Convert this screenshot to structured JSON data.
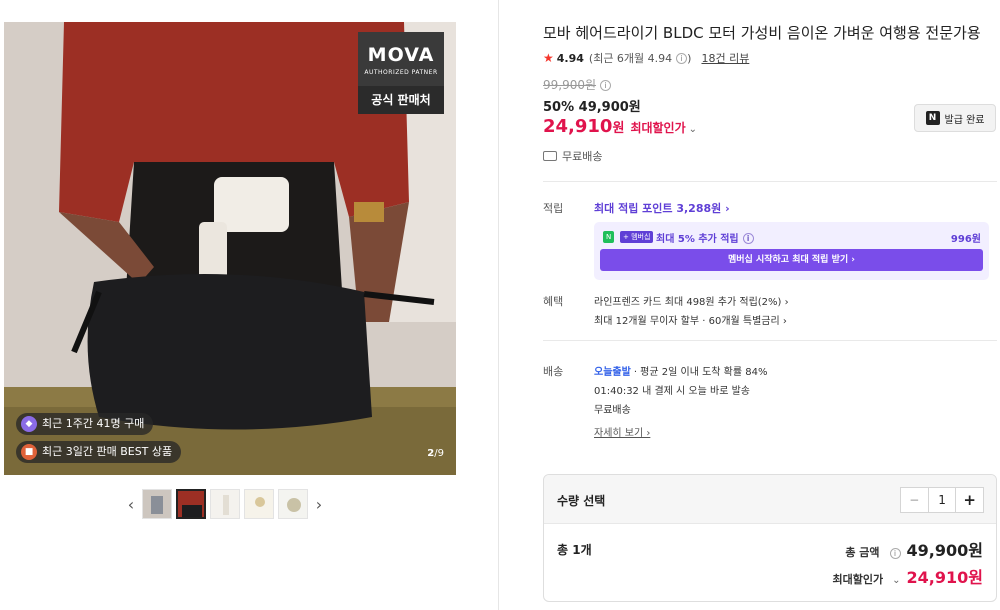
{
  "gallery": {
    "brand_logo": "MOVA",
    "brand_sub": "AUTHORIZED PATNER",
    "brand_foot": "공식 판매처",
    "badge_recent": "최근 1주간 41명 구매",
    "badge_best": "최근 3일간 판매 BEST 상품",
    "counter_current": "2",
    "counter_total": "/9",
    "prev_arrow": "‹",
    "next_arrow": "›"
  },
  "product": {
    "title": "모바 헤어드라이기 BLDC 모터 가성비 음이온 가벼운 여행용 전문가용",
    "rating": "4.94",
    "rating_recent": "(최근 6개월 4.94",
    "rating_recent_close": ")",
    "review_link": "18건 리뷰",
    "original_price": "99,900원",
    "discount": "50% 49,900원",
    "final_price": "24,910",
    "won": "원",
    "max_discount_label": "최대할인가",
    "coupon_button": "발급 완료",
    "shipping": "무료배송"
  },
  "points": {
    "label": "적립",
    "link": "최대 적립 포인트 3,288원 ›",
    "tag_n": "N",
    "tag_member": "+ 멤버십",
    "member_text": "최대 5% 추가 적립",
    "member_amount": "996원",
    "member_button": "멤버십 시작하고 최대 적립 받기 ›"
  },
  "benefits": {
    "label": "혜택",
    "line1": "라인프렌즈 카드 최대 498원 추가 적립(2%) ›",
    "line2": "최대 12개월 무이자 할부 · 60개월 특별금리 ›"
  },
  "delivery": {
    "label": "배송",
    "today": "오늘출발",
    "today_rest": "· 평균 2일 이내 도착 확률 84%",
    "line2": "01:40:32  내 결제 시 오늘 바로 발송",
    "line3": "무료배송",
    "detail_link": "자세히 보기 ›"
  },
  "order": {
    "qty_label": "수량 선택",
    "minus": "−",
    "qty": "1",
    "plus": "+",
    "total_label": "총 1개",
    "sum_label": "총 금액",
    "sum_value": "49,900원",
    "max_label": "최대할인가",
    "max_value": "24,910원"
  }
}
